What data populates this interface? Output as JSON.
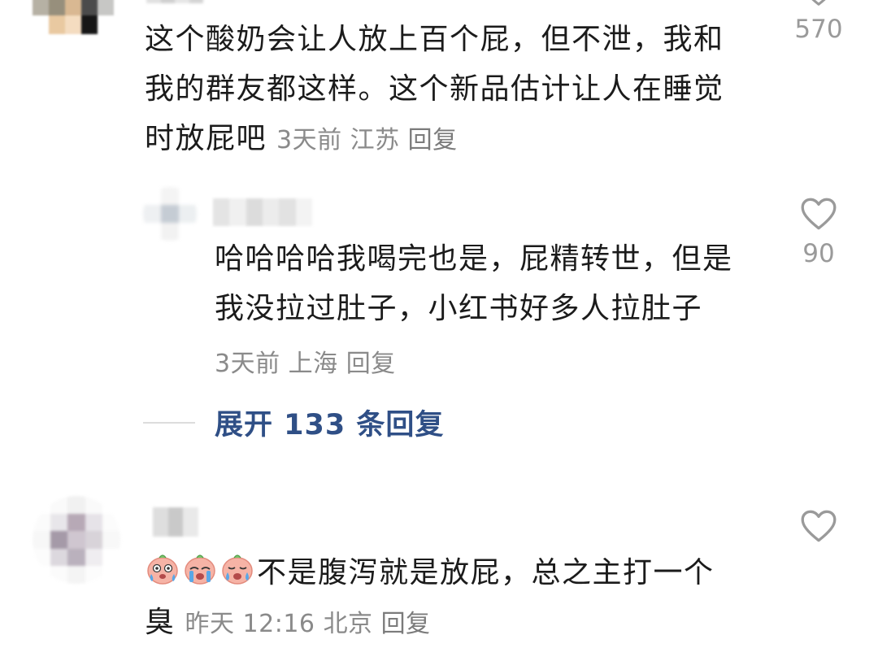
{
  "comments": [
    {
      "text_lines": [
        "这个酸奶会让人放上百个屁，但不泄，我和",
        "我的群友都这样。这个新品估计让人在睡觉",
        "时放屁吧"
      ],
      "time": "3天前",
      "location": "江苏",
      "reply_label": "回复",
      "likes": "570"
    },
    {
      "text_lines": [
        "哈哈哈哈我喝完也是，屁精转世，但是",
        "我没拉过肚子，小红书好多人拉肚子"
      ],
      "time": "3天前",
      "location": "上海",
      "reply_label": "回复",
      "likes": "90"
    },
    {
      "text_lines": [
        "不是腹泻就是放屁，总之主打一个",
        "臭"
      ],
      "time": "昨天 12:16",
      "location": "北京",
      "reply_label": "回复",
      "likes": ""
    }
  ],
  "expand_replies": "展开 133 条回复",
  "icons": {
    "heart": "heart-outline-icon",
    "emoji": "crying-emoji-icon"
  },
  "colors": {
    "text": "#1b1b1b",
    "meta": "#8a8a8a",
    "link": "#2f4f86",
    "heart": "#9a9a9a"
  }
}
